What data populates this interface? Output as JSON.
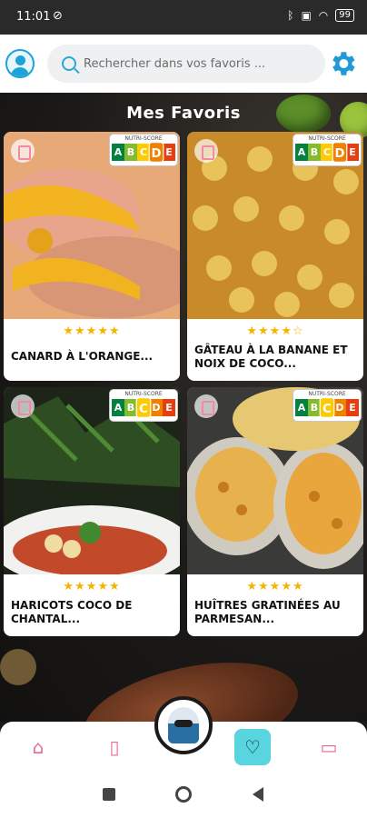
{
  "status": {
    "time": "11:01",
    "battery": "99"
  },
  "search": {
    "placeholder": "Rechercher dans vos favoris ..."
  },
  "page": {
    "title": "Mes Favoris"
  },
  "nutriscore_label": "NUTRI-SCORE",
  "nutriscore_letters": [
    "A",
    "B",
    "C",
    "D",
    "E"
  ],
  "recipes": [
    {
      "title": "Canard à l'orange...",
      "stars": "★★★★★",
      "rating": 5,
      "nutriscore": "D"
    },
    {
      "title": "Gâteau à la banane et noix de coco...",
      "stars": "★★★★☆",
      "rating": 4,
      "nutriscore": "D"
    },
    {
      "title": "Haricots coco de Chantal...",
      "stars": "★★★★★",
      "rating": 5,
      "nutriscore": "C"
    },
    {
      "title": "Huîtres gratinées au parmesan...",
      "stars": "★★★★★",
      "rating": 4.5,
      "nutriscore": "C"
    }
  ],
  "colors": {
    "accent": "#1fa2d6",
    "nav_active": "#58d5de",
    "nav_icon": "#e66a9a",
    "stars": "#f4b400"
  },
  "nav": [
    {
      "icon": "home-icon",
      "glyph": "⌂"
    },
    {
      "icon": "fridge-icon",
      "glyph": "▯"
    },
    {
      "icon": "heart-icon",
      "glyph": "♡"
    },
    {
      "icon": "clipboard-icon",
      "glyph": "▭"
    }
  ]
}
